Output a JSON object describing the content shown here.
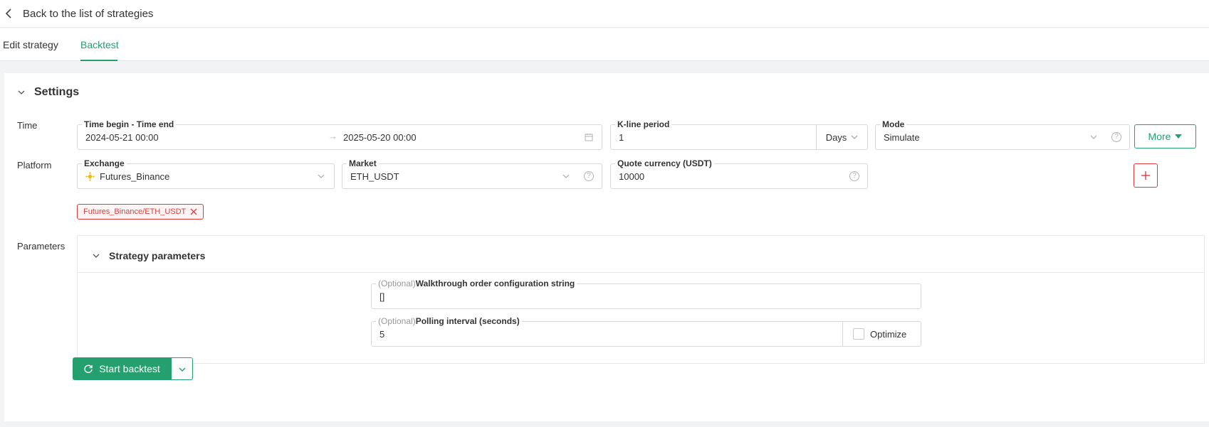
{
  "header": {
    "back_label": "Back to the list of strategies"
  },
  "tabs": [
    {
      "label": "Edit strategy",
      "active": false
    },
    {
      "label": "Backtest",
      "active": true
    }
  ],
  "settings": {
    "title": "Settings",
    "rows": {
      "time": "Time",
      "platform": "Platform",
      "parameters": "Parameters"
    },
    "time_range": {
      "label": "Time begin - Time end",
      "start": "2024-05-21 00:00",
      "end": "2025-05-20 00:00"
    },
    "kline": {
      "label": "K-line period",
      "value": "1",
      "unit": "Days"
    },
    "mode": {
      "label": "Mode",
      "value": "Simulate"
    },
    "more_label": "More",
    "exchange": {
      "label": "Exchange",
      "value": "Futures_Binance"
    },
    "market": {
      "label": "Market",
      "value": "ETH_USDT"
    },
    "quote": {
      "label": "Quote currency (USDT)",
      "value": "10000"
    },
    "tags": [
      "Futures_Binance/ETH_USDT"
    ]
  },
  "strategy_params": {
    "title": "Strategy parameters",
    "walkthrough": {
      "optional": "(Optional)",
      "label": "Walkthrough order configuration string",
      "value": "[]"
    },
    "polling": {
      "optional": "(Optional)",
      "label": "Polling interval (seconds)",
      "value": "5",
      "optimize_label": "Optimize",
      "optimize_checked": false
    }
  },
  "actions": {
    "start_label": "Start backtest"
  },
  "colors": {
    "accent": "#23a06d",
    "danger": "#e03b3b",
    "binance": "#f0b90b"
  }
}
